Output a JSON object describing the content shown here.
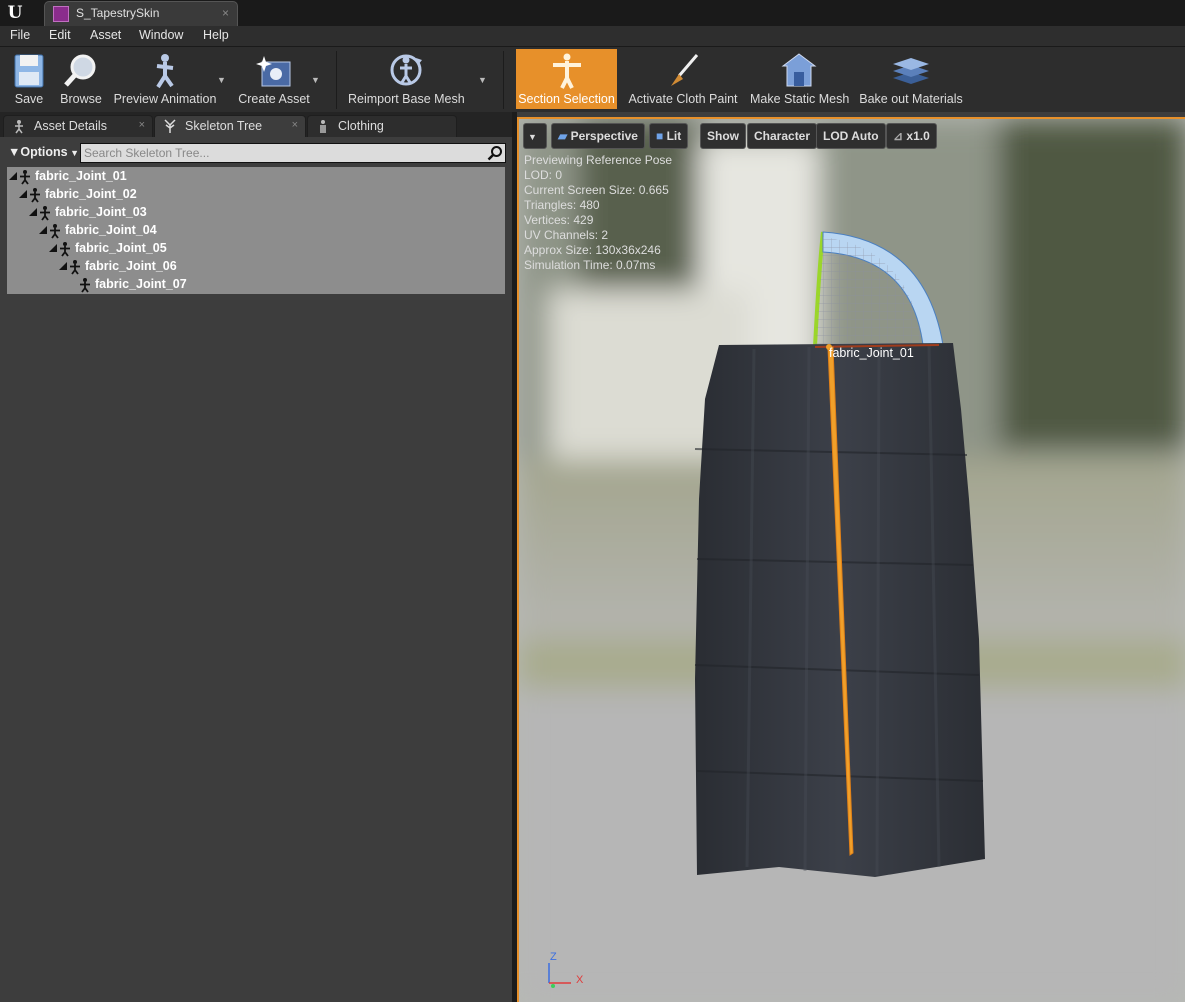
{
  "titlebar": {
    "tab_title": "S_TapestrySkin",
    "logo": "U",
    "close": "×"
  },
  "menu": [
    "File",
    "Edit",
    "Asset",
    "Window",
    "Help"
  ],
  "toolbar": {
    "save": "Save",
    "browse": "Browse",
    "preview_animation": "Preview Animation",
    "create_asset": "Create Asset",
    "reimport_base_mesh": "Reimport Base Mesh",
    "section_selection": "Section Selection",
    "activate_cloth_paint": "Activate Cloth Paint",
    "make_static_mesh": "Make Static Mesh",
    "bake_out_materials": "Bake out Materials",
    "accent_color": "#e7902a"
  },
  "panel_tabs": [
    {
      "label": "Asset Details",
      "icon": "asset-details-icon"
    },
    {
      "label": "Skeleton Tree",
      "icon": "skeleton-icon"
    },
    {
      "label": "Clothing",
      "icon": "clothing-icon"
    }
  ],
  "skeleton_tree": {
    "options_label": "Options",
    "search_placeholder": "Search Skeleton Tree...",
    "bones": [
      "fabric_Joint_01",
      "fabric_Joint_02",
      "fabric_Joint_03",
      "fabric_Joint_04",
      "fabric_Joint_05",
      "fabric_Joint_06",
      "fabric_Joint_07"
    ]
  },
  "viewport": {
    "buttons": {
      "perspective": "Perspective",
      "lit": "Lit",
      "show": "Show",
      "character": "Character",
      "lod": "LOD Auto",
      "speed": "x1.0"
    },
    "stats": [
      "Previewing Reference Pose",
      "LOD: 0",
      "Current Screen Size: 0.665",
      "Triangles: 480",
      "Vertices: 429",
      "UV Channels: 2",
      "Approx Size: 130x36x246",
      "Simulation Time: 0.07ms"
    ],
    "joint_label": "fabric_Joint_01",
    "axis_z": "Z",
    "axis_x": "X"
  }
}
